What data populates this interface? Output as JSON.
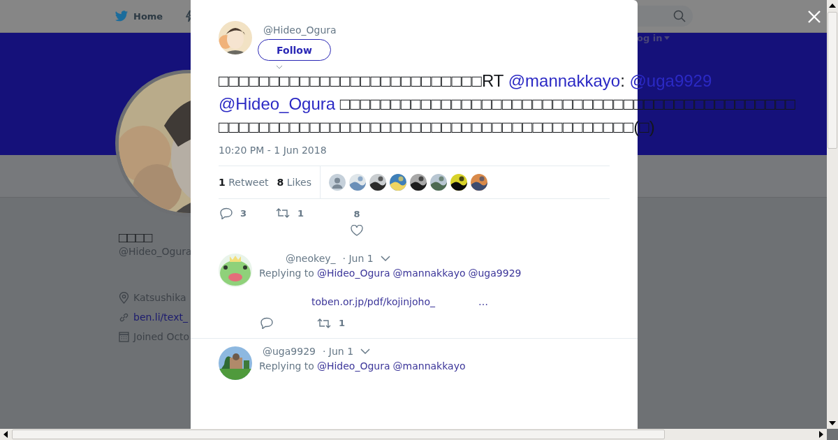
{
  "nav": {
    "home": "Home",
    "login": "og in"
  },
  "profile": {
    "name": "□□□□",
    "handle": "@Hideo_Ogura",
    "location": "Katsushika",
    "url": "ben.li/text_",
    "joined": "Joined Octo"
  },
  "tweet": {
    "handle": "@Hideo_Ogura",
    "follow": "Follow",
    "lines": [
      [
        {
          "kind": "text",
          "text": "□□□□□□□□□□□□□□□□□□□□□□□□□□RT "
        },
        {
          "kind": "mention",
          "text": "@mannakkayo"
        },
        {
          "kind": "text",
          "text": ": "
        },
        {
          "kind": "mention",
          "text": "@uga9929"
        }
      ],
      [
        {
          "kind": "mention",
          "text": "@Hideo_Ogura"
        },
        {
          "kind": "text",
          "text": " □□□□□□□□□□□□□□□□□□□□□□□□□□□□□□□□□□□□□□□□□□□□□"
        }
      ],
      [
        {
          "kind": "text",
          "text": "□□□□□□□□□□□□□□□□□□□□□□□□□□□□□□□□□□□□□□□□□(□)"
        }
      ]
    ],
    "time": "10:20 PM - 1 Jun 2018",
    "retweets": {
      "count": "1",
      "label": "Retweet"
    },
    "likes": {
      "count": "8",
      "label": "Likes"
    },
    "likers": [
      {
        "kind": "default"
      },
      {
        "kind": "picture"
      },
      {
        "kind": "picture"
      },
      {
        "kind": "picture"
      },
      {
        "kind": "picture"
      },
      {
        "kind": "picture"
      },
      {
        "kind": "picture"
      },
      {
        "kind": "picture"
      }
    ],
    "actions": {
      "replies": "3",
      "retweets": "1",
      "likes": "8"
    }
  },
  "replies": [
    {
      "handle": "@neokey_",
      "date": "· Jun 1",
      "replying_label": "Replying to",
      "mentions": [
        "@Hideo_Ogura",
        "@mannakkayo",
        "@uga9929"
      ],
      "link": "toben.or.jp/pdf/kojinjoho_",
      "ellipsis": "…",
      "retweets": "1"
    },
    {
      "handle": "@uga9929",
      "date": "· Jun 1",
      "replying_label": "Replying to",
      "mentions": [
        "@Hideo_Ogura",
        "@mannakkayo"
      ]
    }
  ]
}
